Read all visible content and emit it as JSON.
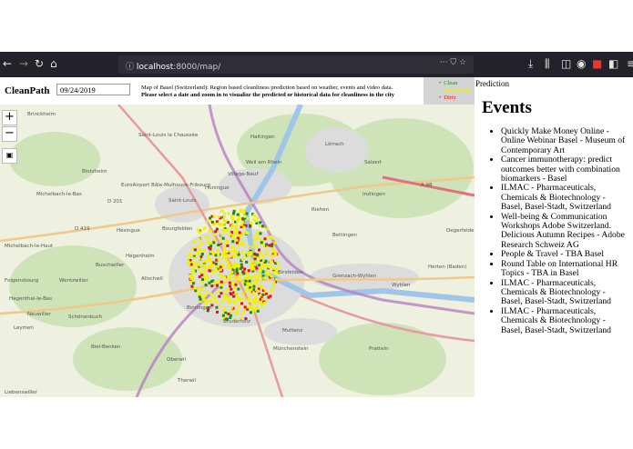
{
  "browser": {
    "url_host": "localhost",
    "url_path": ":8000/map/"
  },
  "app": {
    "brand": "CleanPath",
    "date_value": "09/24/2019",
    "description_line1": "Map of Basel (Switzerland): Region based cleanliness prediction based on weather, events and video data.",
    "description_line2": "Please select a date and zoom in to visualize the predicted or historical data for cleanliness in the city"
  },
  "legend": [
    {
      "label": "Clean",
      "color": "#1a8a1a"
    },
    {
      "label": "Acceptable",
      "color": "#f2f200"
    },
    {
      "label": "Dirty",
      "color": "#e01010"
    }
  ],
  "prediction_label": "Prediction",
  "map": {
    "zoom_in": "+",
    "zoom_out": "−",
    "labels": [
      "Brinckheim",
      "Saint-Louis la Chaussée",
      "Village-Neuf",
      "Blotzheim",
      "EuroAirport Bâle-Mulhouse-Fribourg",
      "Michelbach-le-Bas",
      "D 201",
      "Huningue",
      "Saint-Louis",
      "D 419",
      "Hésingue",
      "Bourgfelden",
      "Michelbach-le-Haut",
      "Hégenheim",
      "Buschwiller",
      "Folgensbourg",
      "Wentzwiller",
      "Allschwil",
      "Lörrach",
      "Weil am Rhein",
      "Riehen",
      "Haltingen",
      "Salzert",
      "Inzlingen",
      "Bettingen",
      "Birsfelden",
      "Grenzach-Wyhlen",
      "Binningen",
      "Bruderholz",
      "Muttenz",
      "Münchenstein",
      "Pratteln",
      "Oberwil",
      "Therwil",
      "Leymen",
      "Biel-Benken",
      "Neuwiller",
      "Hagenthal-le-Bas",
      "Liebenswiller",
      "Schönenbuch",
      "Herten (Baden)",
      "Degerfelden",
      "A 98",
      "Wyhlen"
    ]
  },
  "events": {
    "title": "Events",
    "items": [
      "Quickly Make Money Online - Online Webinar Basel - Museum of Contemporary Art",
      "Cancer immunotherapy: predict outcomes better with combination biomarkers - Basel",
      "ILMAC - Pharmaceuticals, Chemicals & Biotechnology - Basel, Basel-Stadt, Switzerland",
      "Well-being & Communication Workshops Adobe Switzerland. Delicious Autumn Recipes - Adobe Research Schweiz AG",
      "People & Travel - TBA Basel",
      "Round Table on International HR Topics - TBA in Basel",
      "ILMAC - Pharmaceuticals, Chemicals & Biotechnology - Basel, Basel-Stadt, Switzerland",
      "ILMAC - Pharmaceuticals, Chemicals & Biotechnology - Basel, Basel-Stadt, Switzerland"
    ]
  }
}
